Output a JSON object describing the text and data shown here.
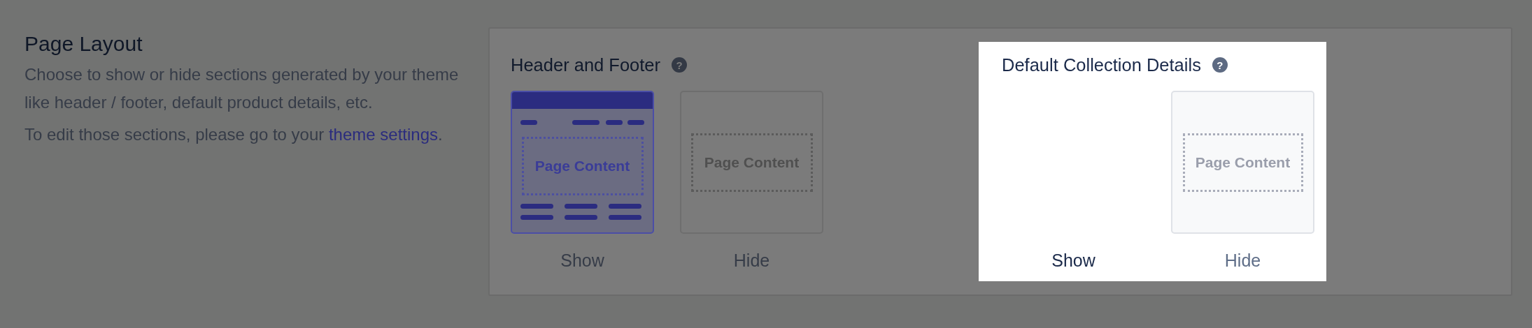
{
  "intro": {
    "title": "Page Layout",
    "description": "Choose to show or hide sections generated by your theme like header / footer, default product details, etc.",
    "edit_text": "To edit those sections, please go to your",
    "link": "theme settings",
    "link_after": "."
  },
  "sections": [
    {
      "title": "Header and Footer",
      "help": "?",
      "highlighted": false,
      "options": [
        {
          "label": "Show",
          "kind": "header-footer",
          "preview_text": "Page Content",
          "selected": true
        },
        {
          "label": "Hide",
          "kind": "content-only",
          "preview_text": "Page Content",
          "selected": false
        }
      ]
    },
    {
      "title": "Default Collection Details",
      "help": "?",
      "highlighted": true,
      "options": [
        {
          "label": "Show",
          "kind": "blank",
          "selected": false
        },
        {
          "label": "Hide",
          "kind": "content-only",
          "preview_text": "Page Content",
          "selected": false
        }
      ]
    }
  ]
}
